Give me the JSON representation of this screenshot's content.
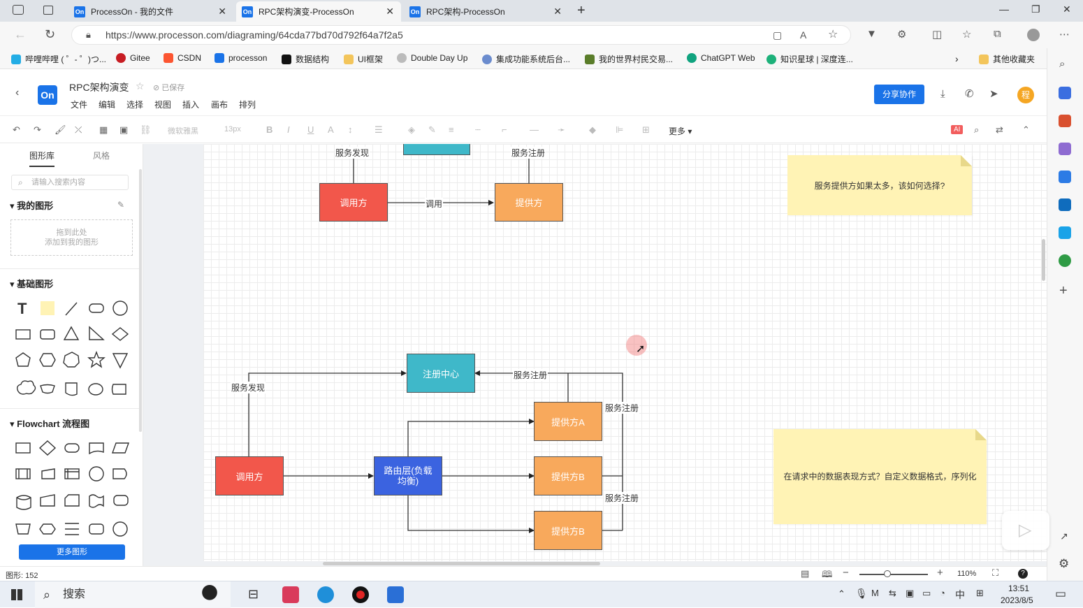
{
  "browser": {
    "tabs": [
      {
        "label": "ProcessOn - 我的文件",
        "favicon": "On"
      },
      {
        "label": "RPC架构演变-ProcessOn",
        "favicon": "On"
      },
      {
        "label": "RPC架构-ProcessOn",
        "favicon": "On"
      }
    ],
    "url": "https://www.processon.com/diagraming/64cda77bd70d792f64a7f2a5",
    "bookmarks": [
      "哔哩哔哩 ( ゜- ゜)つ...",
      "Gitee",
      "CSDN",
      "processon",
      "数据结构",
      "UI框架",
      "Double Day Up",
      "集成功能系统后台...",
      "我的世界村民交易...",
      "ChatGPT Web",
      "知识星球 | 深度连...",
      "其他收藏夹"
    ]
  },
  "app": {
    "logo": "On",
    "title": "RPC架构演变",
    "saved": "已保存",
    "menu": [
      "文件",
      "编辑",
      "选择",
      "视图",
      "插入",
      "画布",
      "排列"
    ],
    "share": "分享协作",
    "avatar": "程"
  },
  "toolbar": {
    "font": "微软雅黑",
    "size": "13px",
    "more": "更多",
    "ai": "AI"
  },
  "leftpanel": {
    "tabs": [
      "图形库",
      "风格"
    ],
    "search_placeholder": "请输入搜索内容",
    "my_shapes": "我的图形",
    "dropzone_line1": "拖到此处",
    "dropzone_line2": "添加到我的图形",
    "basic": "基础图形",
    "flowchart": "Flowchart 流程图",
    "more_shapes": "更多图形"
  },
  "diagram": {
    "top": {
      "caller": "调用方",
      "provider": "提供方",
      "call": "调用",
      "discovery": "服务发现",
      "register": "服务注册"
    },
    "bottom": {
      "registry": "注册中心",
      "caller": "调用方",
      "router": "路由层(负载均衡)",
      "providerA": "提供方A",
      "providerB1": "提供方B",
      "providerB2": "提供方B",
      "discovery": "服务发现",
      "register1": "服务注册",
      "register2": "服务注册",
      "register3": "服务注册"
    },
    "notes": [
      "服务提供方如果太多，该如何选择?",
      "在请求中的数据表现方式？自定义数据格式，序列化"
    ],
    "colors": {
      "red": "#f2574b",
      "orange": "#f8a95c",
      "teal": "#3fb8c9",
      "blue": "#3b63e0",
      "note": "#fff3b5"
    }
  },
  "status": {
    "shapes": "图形: 152",
    "zoom": "110%"
  },
  "taskbar": {
    "search": "搜索",
    "time": "13:51",
    "date": "2023/8/5",
    "ime": "中"
  }
}
